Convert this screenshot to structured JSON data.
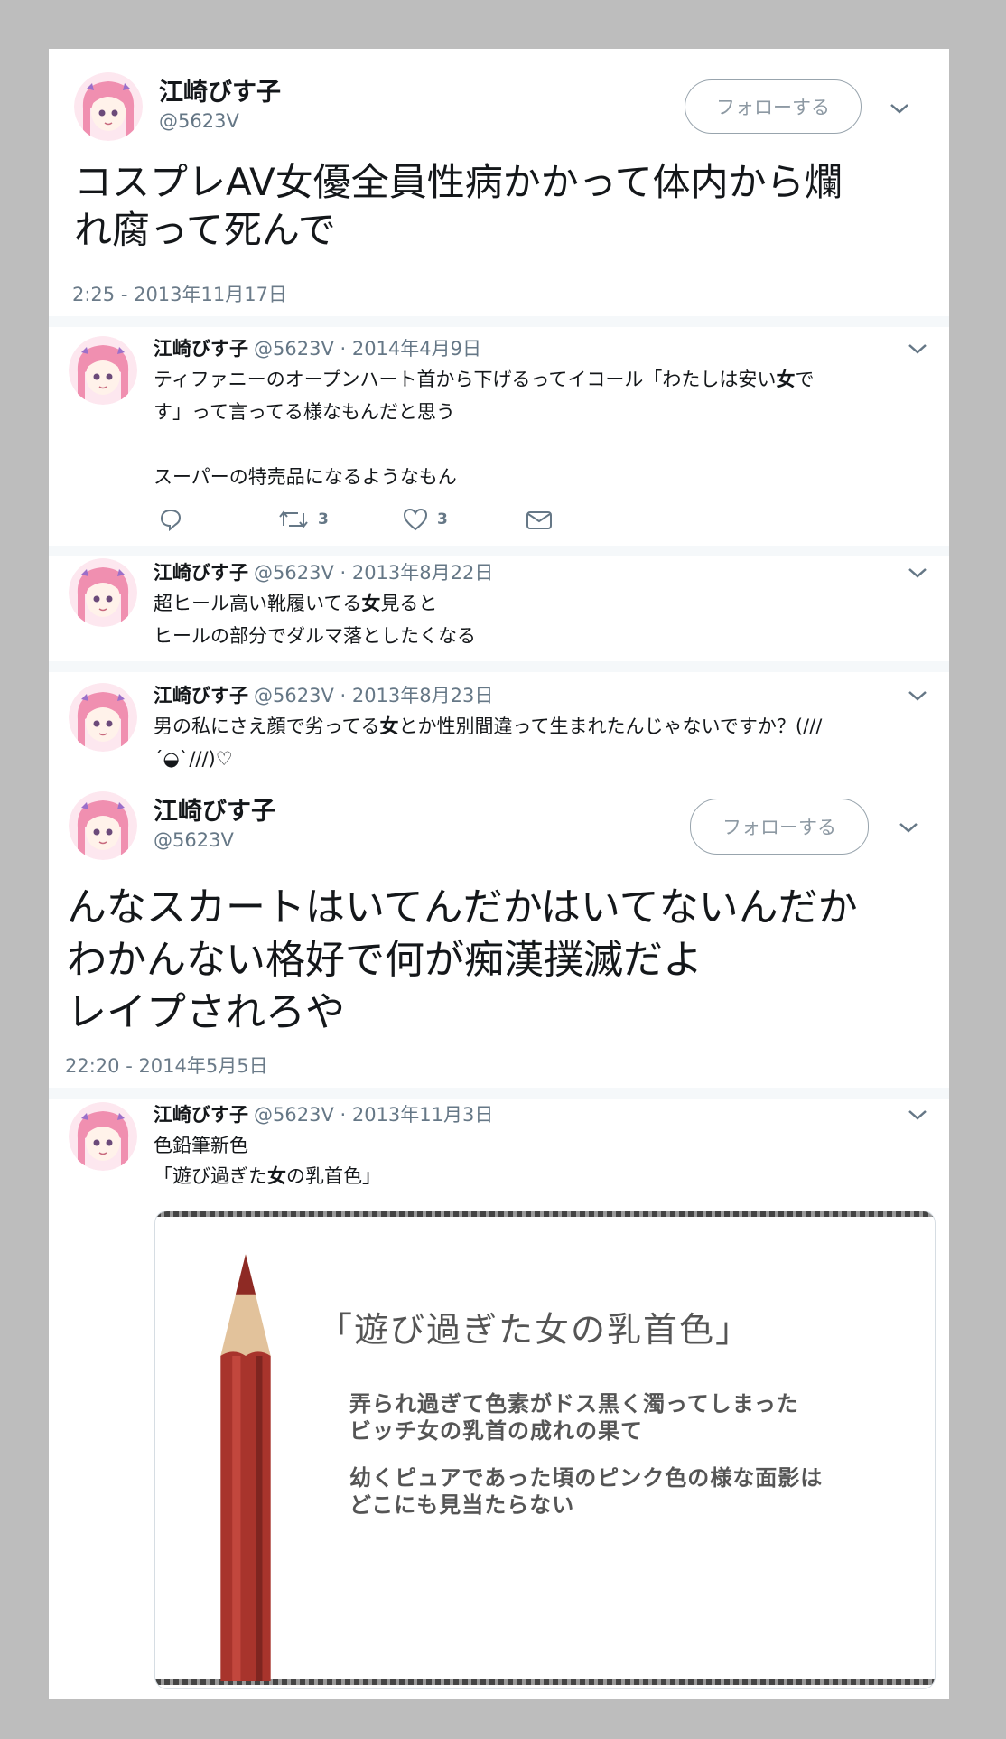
{
  "tweet1": {
    "name": "江崎びす子",
    "handle": "@5623V",
    "follow_label": "フォローする",
    "text": "コスプレAV女優全員性病かかって体内から爛\nれ腐って死んで",
    "timestamp": "2:25 - 2013年11月17日"
  },
  "reply1": {
    "name": "江崎びす子",
    "handle_date": "@5623V · 2014年4月9日",
    "text_before": "ティファニーのオープンハート首から下げるってイコール「わたしは安い",
    "text_bold": "女",
    "text_after": "で\nす」って言ってる様なもんだと思う\n\nスーパーの特売品になるようなもん",
    "retweet_count": "3",
    "like_count": "3"
  },
  "reply2": {
    "name": "江崎びす子",
    "handle_date": "@5623V · 2013年8月22日",
    "text_before": "超ヒール高い靴履いてる",
    "text_bold": "女",
    "text_after": "見ると\nヒールの部分でダルマ落としたくなる"
  },
  "reply3": {
    "name": "江崎びす子",
    "handle_date": "@5623V · 2013年8月23日",
    "text_before": "男の私にさえ顔で劣ってる",
    "text_bold": "女",
    "text_after": "とか性別間違って生まれたんじゃないですか？(///\n´◒`///)♡"
  },
  "tweet2": {
    "name": "江崎びす子",
    "handle": "@5623V",
    "follow_label": "フォローする",
    "text": "んなスカートはいてんだかはいてないんだか\nわかんない格好で何が痴漢撲滅だよ\nレイプされろや",
    "timestamp": "22:20 - 2014年5月5日"
  },
  "reply4": {
    "name": "江崎びす子",
    "handle_date": "@5623V · 2013年11月3日",
    "line1": "色鉛筆新色",
    "text_before": "「遊び過ぎた",
    "text_bold": "女",
    "text_after": "の乳首色」",
    "media_title": "「遊び過ぎた女の乳首色」",
    "media_line1": "弄られ過ぎて色素がドス黒く濁ってしまった\nビッチ女の乳首の成れの果て",
    "media_line2": "幼くピュアであった頃のピンク色の様な面影は\nどこにも見当たらない"
  },
  "colors": {
    "background": "#bdbdbd",
    "card": "#ffffff",
    "muted_text": "#657786",
    "pencil_body": "#a8342c",
    "pencil_wood": "#e2c29b"
  }
}
